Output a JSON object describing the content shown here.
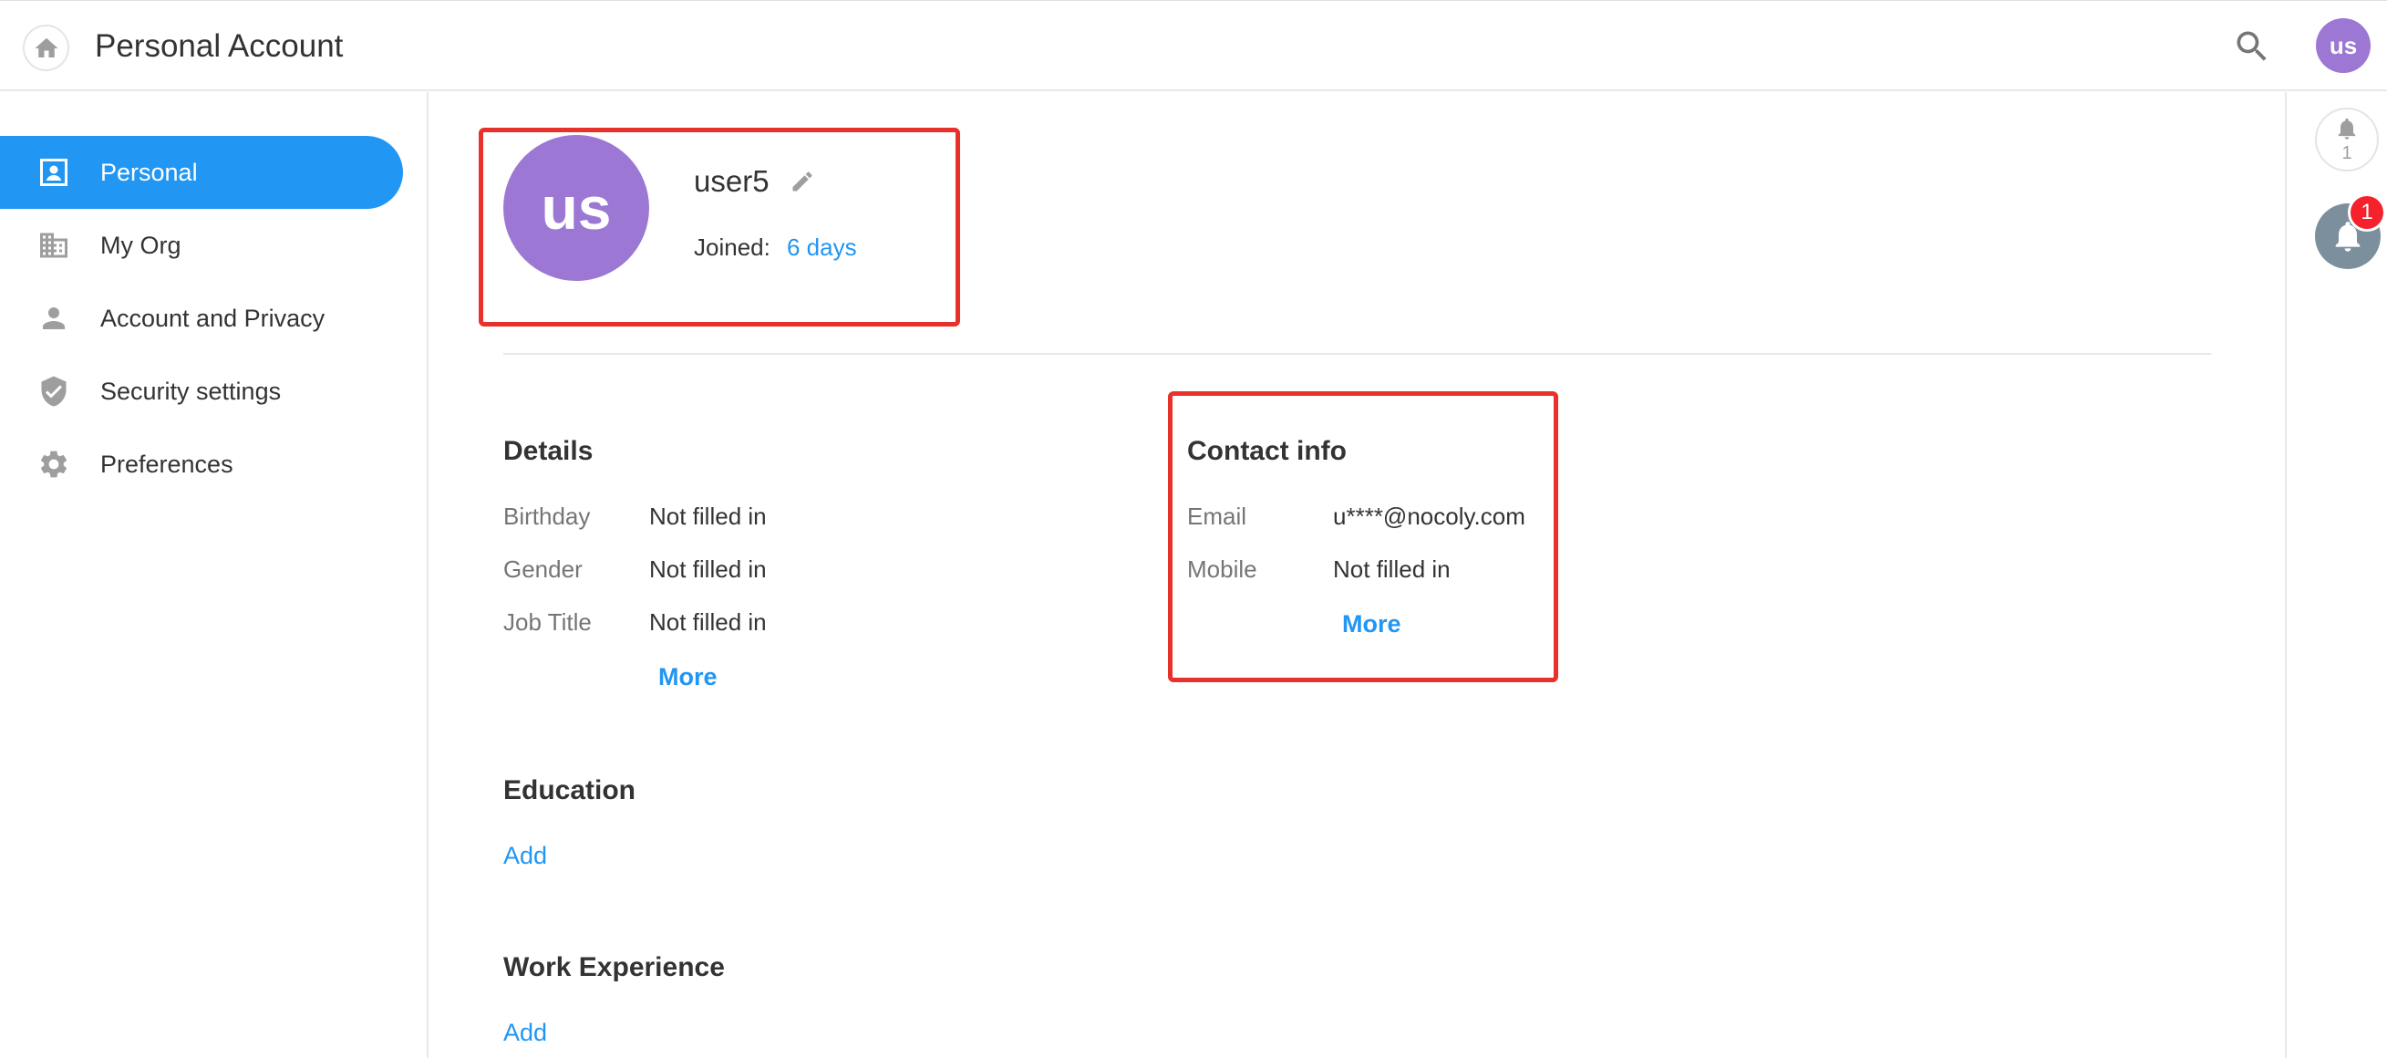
{
  "header": {
    "title": "Personal Account",
    "home_icon": "home-icon",
    "search_icon": "search-icon",
    "avatar_initials": "us"
  },
  "sidebar": {
    "items": [
      {
        "label": "Personal",
        "icon": "profile-card-icon",
        "active": true
      },
      {
        "label": "My Org",
        "icon": "building-icon",
        "active": false
      },
      {
        "label": "Account and Privacy",
        "icon": "person-icon",
        "active": false
      },
      {
        "label": "Security settings",
        "icon": "shield-icon",
        "active": false
      },
      {
        "label": "Preferences",
        "icon": "gear-icon",
        "active": false
      }
    ]
  },
  "profile": {
    "avatar_initials": "us",
    "username": "user5",
    "joined_label": "Joined:",
    "joined_value": "6 days"
  },
  "details": {
    "title": "Details",
    "fields": [
      {
        "label": "Birthday",
        "value": "Not filled in"
      },
      {
        "label": "Gender",
        "value": "Not filled in"
      },
      {
        "label": "Job Title",
        "value": "Not filled in"
      }
    ],
    "more_label": "More"
  },
  "contact": {
    "title": "Contact info",
    "fields": [
      {
        "label": "Email",
        "value": "u****@nocoly.com"
      },
      {
        "label": "Mobile",
        "value": "Not filled in"
      }
    ],
    "more_label": "More"
  },
  "education": {
    "title": "Education",
    "add_label": "Add"
  },
  "work": {
    "title": "Work Experience",
    "add_label": "Add"
  },
  "rail": {
    "bell_count": "1",
    "notification_badge": "1"
  },
  "colors": {
    "accent": "#2196f3",
    "avatar": "#9c77d3",
    "highlight_box": "#e8312a",
    "badge": "#f5222d"
  }
}
